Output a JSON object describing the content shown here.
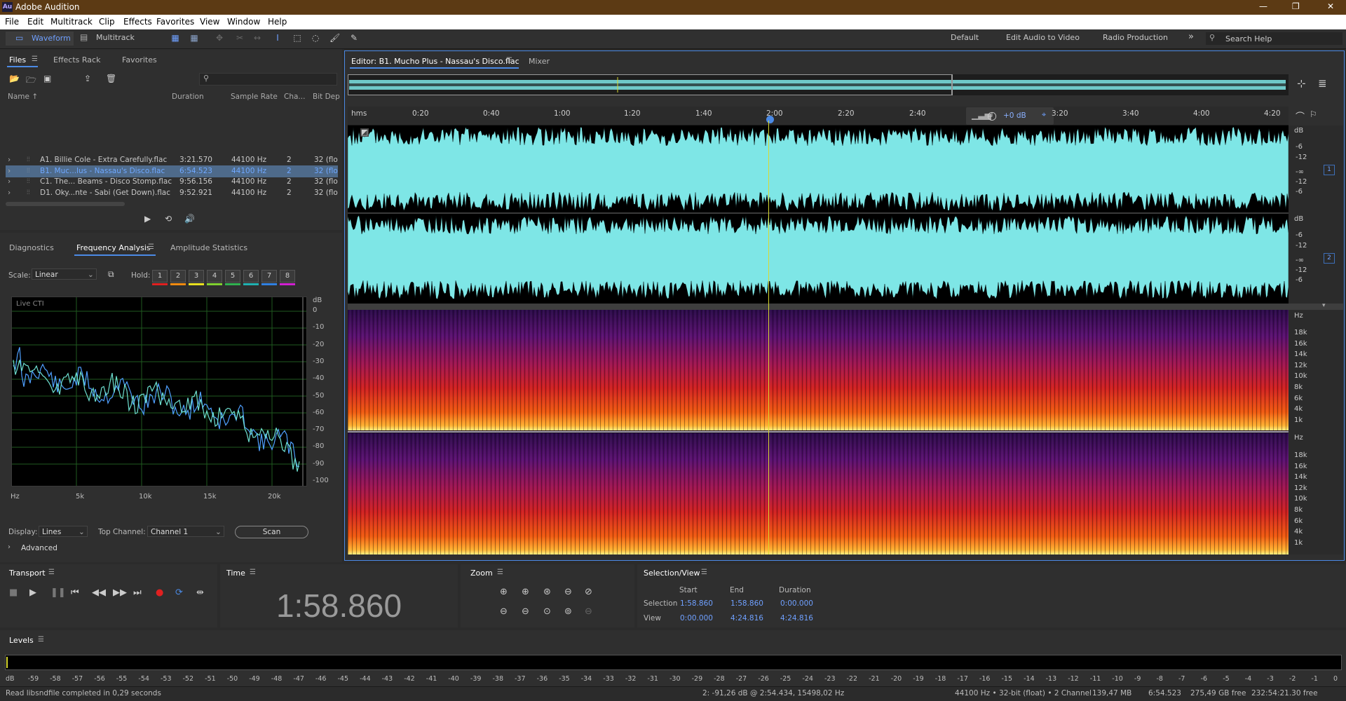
{
  "window": {
    "title": "Adobe Audition",
    "app_icon": "Au"
  },
  "menu": [
    "File",
    "Edit",
    "Multitrack",
    "Clip",
    "Effects",
    "Favorites",
    "View",
    "Window",
    "Help"
  ],
  "toolbar": {
    "waveform_label": "Waveform",
    "multitrack_label": "Multitrack",
    "workspaces": [
      "Default",
      "Edit Audio to Video",
      "Radio Production"
    ],
    "more": "»",
    "search_placeholder": "Search Help"
  },
  "files_panel": {
    "tabs": [
      "Files",
      "Effects Rack",
      "Favorites"
    ],
    "columns": [
      "Name ↑",
      "Duration",
      "Sample Rate",
      "Cha...",
      "Bit Dep"
    ],
    "rows": [
      {
        "name": "A1. Billie Cole - Extra Carefully.flac",
        "duration": "3:21.570",
        "rate": "44100 Hz",
        "ch": "2",
        "bits": "32 (flo",
        "selected": false
      },
      {
        "name": "B1. Muc...lus - Nassau's Disco.flac",
        "duration": "6:54.523",
        "rate": "44100 Hz",
        "ch": "2",
        "bits": "32 (flo",
        "selected": true
      },
      {
        "name": "C1. The... Beams - Disco Stomp.flac",
        "duration": "9:56.156",
        "rate": "44100 Hz",
        "ch": "2",
        "bits": "32 (flo",
        "selected": false
      },
      {
        "name": "D1. Oky...nte - Sabi (Get Down).flac",
        "duration": "9:52.921",
        "rate": "44100 Hz",
        "ch": "2",
        "bits": "32 (flo",
        "selected": false
      }
    ]
  },
  "analysis_panel": {
    "tabs": [
      "Diagnostics",
      "Frequency Analysis",
      "Amplitude Statistics"
    ],
    "scale_label": "Scale:",
    "scale_value": "Linear",
    "hold_label": "Hold:",
    "hold_buttons": [
      "1",
      "2",
      "3",
      "4",
      "5",
      "6",
      "7",
      "8"
    ],
    "hold_colors": [
      "#e02020",
      "#f08a10",
      "#e8e020",
      "#80d030",
      "#30b050",
      "#20b0b0",
      "#3080e0",
      "#d020d0"
    ],
    "graph_label": "Live CTI",
    "db_unit": "dB",
    "db_ticks": [
      "0",
      "-10",
      "-20",
      "-30",
      "-40",
      "-50",
      "-60",
      "-70",
      "-80",
      "-90",
      "-100"
    ],
    "x_ticks": [
      "Hz",
      "5k",
      "10k",
      "15k",
      "20k"
    ],
    "display_label": "Display:",
    "display_value": "Lines",
    "top_channel_label": "Top Channel:",
    "top_channel_value": "Channel 1",
    "scan_label": "Scan",
    "advanced_label": "Advanced"
  },
  "editor": {
    "tab_label": "Editor: B1. Mucho Plus - Nassau's Disco.flac",
    "mixer_label": "Mixer",
    "time_unit": "hms",
    "ruler": [
      "0:20",
      "0:40",
      "1:00",
      "1:20",
      "1:40",
      "2:00",
      "2:20",
      "2:40",
      "3:20",
      "3:40",
      "4:00",
      "4:20"
    ],
    "hud_db": "+0 dB",
    "db_unit": "dB",
    "channel_db": [
      "-6",
      "-12",
      "-∞",
      "-12",
      "-6"
    ],
    "channels": [
      "1",
      "2"
    ],
    "hz_unit": "Hz",
    "hz_ticks": [
      "18k",
      "16k",
      "14k",
      "12k",
      "10k",
      "8k",
      "6k",
      "4k",
      "1k"
    ],
    "playhead_fraction": 0.447,
    "colors": {
      "waveform": "#7ee6e6",
      "playhead": "#d8d830",
      "selection": "#4b8ae5"
    }
  },
  "transport": {
    "title": "Transport"
  },
  "time_panel": {
    "title": "Time",
    "value": "1:58.860"
  },
  "zoom_panel": {
    "title": "Zoom"
  },
  "selection_view": {
    "title": "Selection/View",
    "headers": [
      "Start",
      "End",
      "Duration"
    ],
    "selection_label": "Selection",
    "view_label": "View",
    "selection": [
      "1:58.860",
      "1:58.860",
      "0:00.000"
    ],
    "view": [
      "0:00.000",
      "4:24.816",
      "4:24.816"
    ]
  },
  "levels": {
    "title": "Levels",
    "scale": [
      "dB",
      "-59",
      "-58",
      "-57",
      "-56",
      "-55",
      "-54",
      "-53",
      "-52",
      "-51",
      "-50",
      "-49",
      "-48",
      "-47",
      "-46",
      "-45",
      "-44",
      "-43",
      "-42",
      "-41",
      "-40",
      "-39",
      "-38",
      "-37",
      "-36",
      "-35",
      "-34",
      "-33",
      "-32",
      "-31",
      "-30",
      "-29",
      "-28",
      "-27",
      "-26",
      "-25",
      "-24",
      "-23",
      "-22",
      "-21",
      "-20",
      "-19",
      "-18",
      "-17",
      "-16",
      "-15",
      "-14",
      "-13",
      "-12",
      "-11",
      "-10",
      "-9",
      "-8",
      "-7",
      "-6",
      "-5",
      "-4",
      "-3",
      "-2",
      "-1",
      "0"
    ]
  },
  "status": {
    "message": "Read libsndfile completed in 0,29 seconds",
    "cursor": "2: -91,26 dB @ 2:54.434, 15498,02 Hz",
    "format": "44100 Hz • 32-bit (float) • 2 Channel",
    "size": "139,47 MB",
    "duration": "6:54.523",
    "free": "275,49 GB free",
    "free_time": "232:54:21.30 free"
  }
}
